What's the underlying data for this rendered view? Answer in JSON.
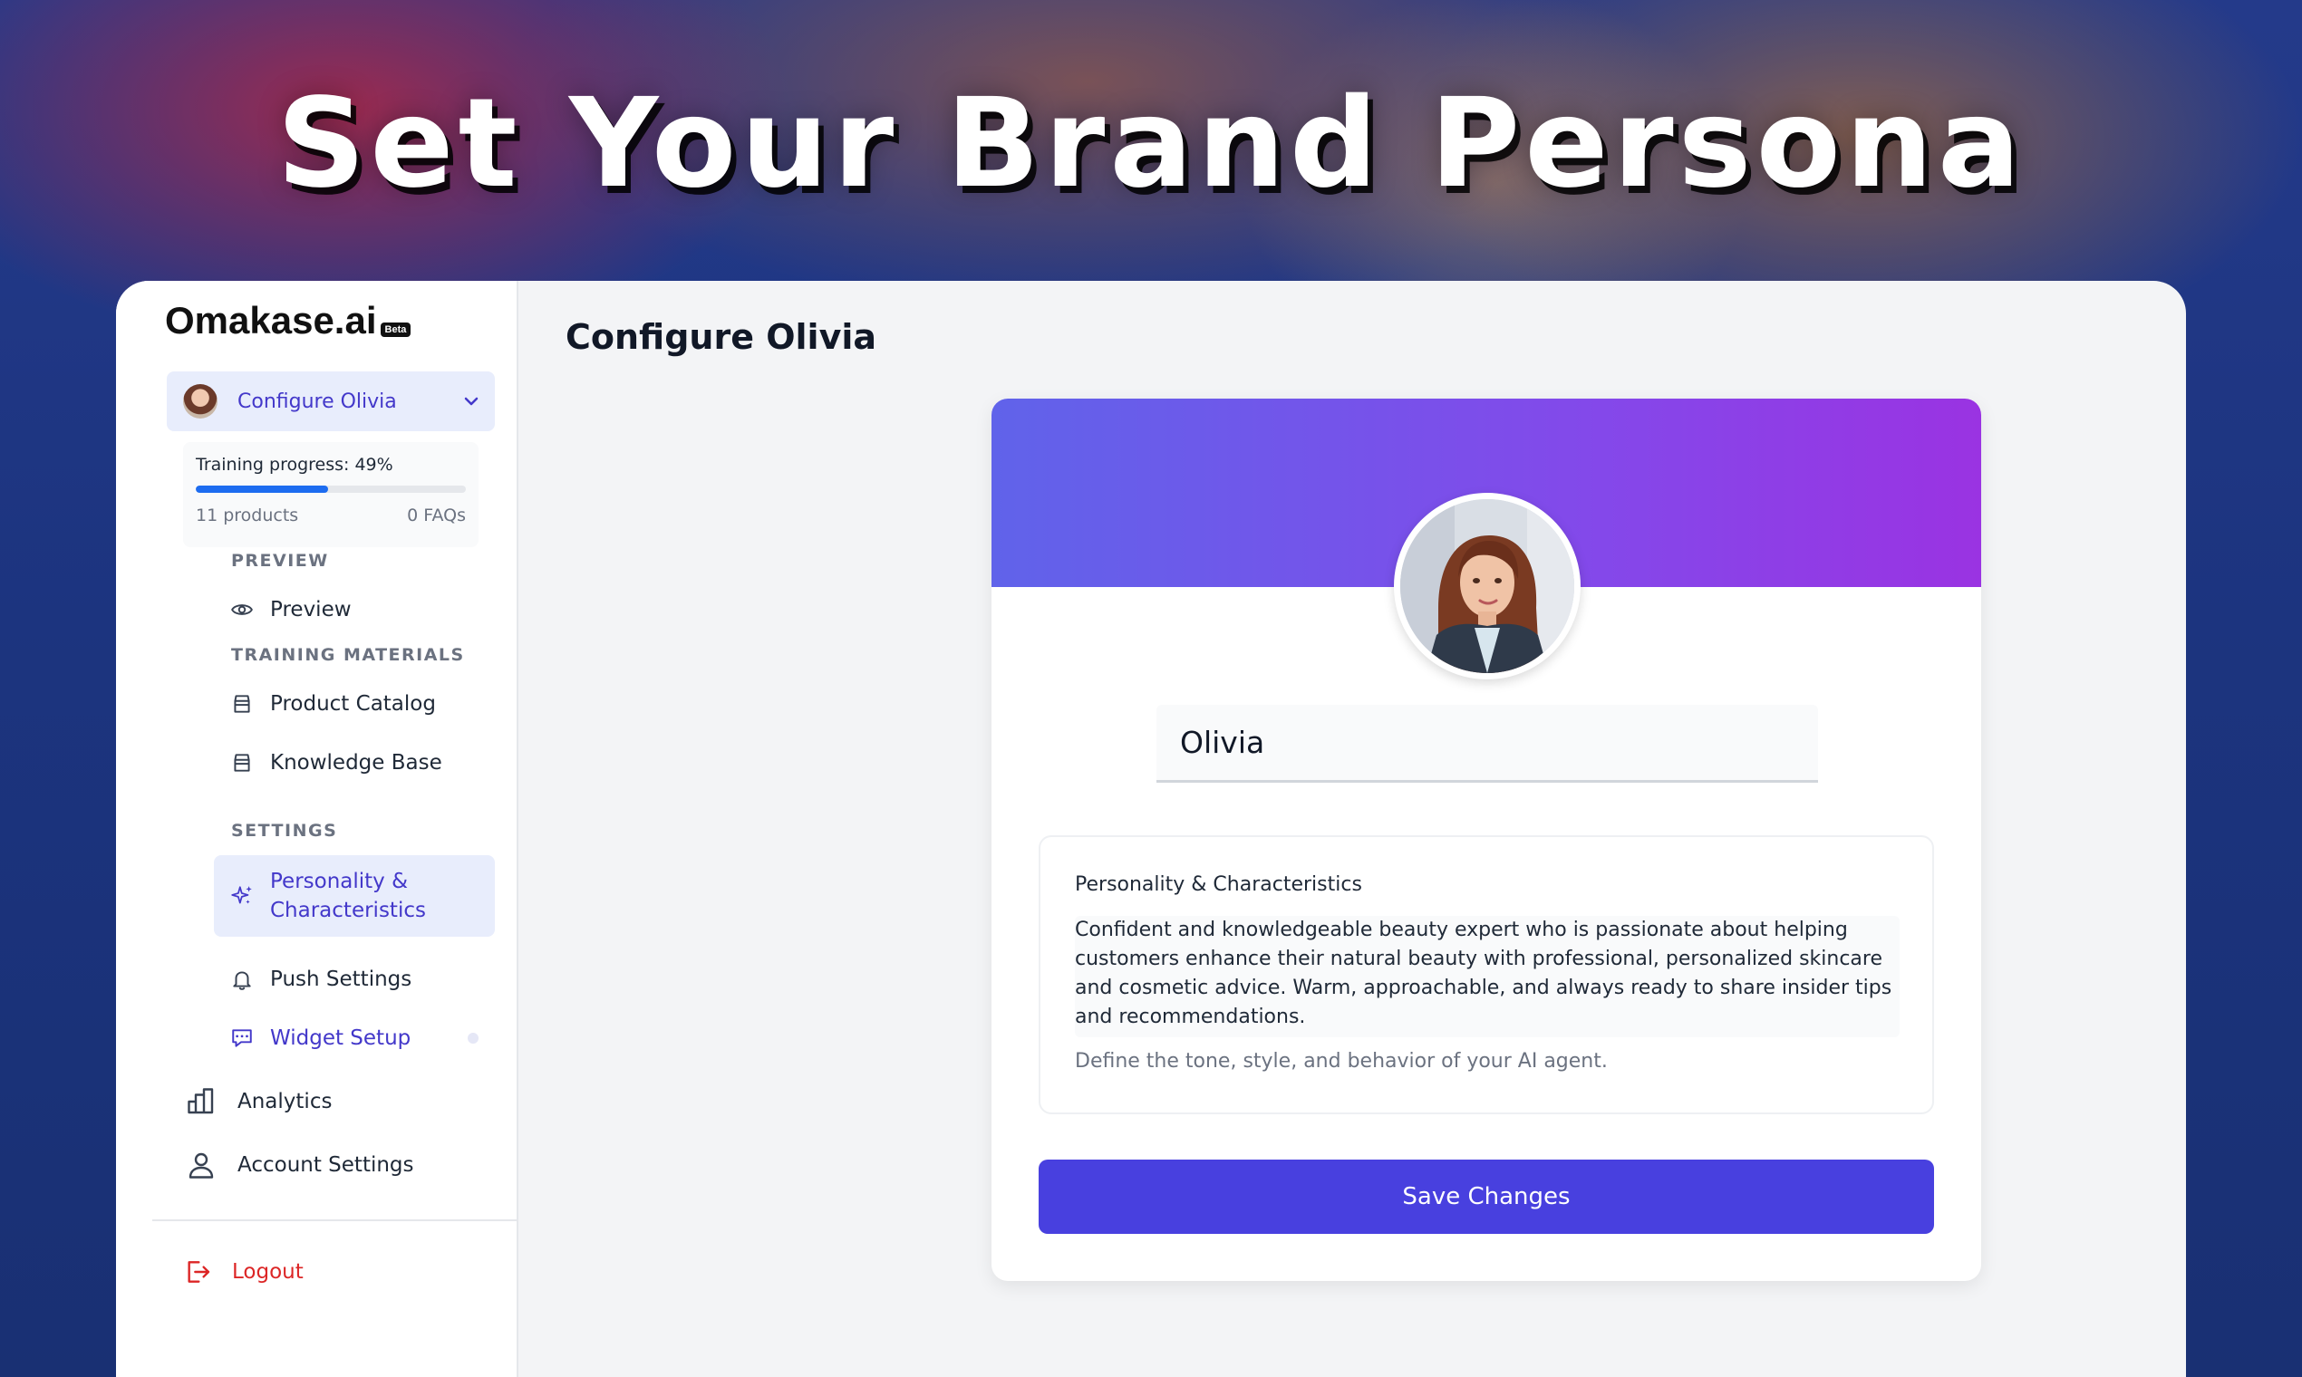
{
  "hero": {
    "title": "Set Your Brand Persona"
  },
  "sidebar": {
    "logo": "Omakase.ai",
    "beta_badge": "Beta",
    "agent_selector": {
      "label": "Configure Olivia"
    },
    "training": {
      "progress_text": "Training progress: 49%",
      "progress_fraction": 0.49,
      "products": "11 products",
      "faqs": "0 FAQs"
    },
    "sections": {
      "preview": "PREVIEW",
      "training_materials": "TRAINING MATERIALS",
      "settings": "SETTINGS"
    },
    "items": {
      "preview": "Preview",
      "product_catalog": "Product Catalog",
      "knowledge_base": "Knowledge Base",
      "personality_line1": "Personality &",
      "personality_line2": "Characteristics",
      "push_settings": "Push Settings",
      "widget_setup": "Widget Setup",
      "analytics": "Analytics",
      "account_settings": "Account Settings",
      "logout": "Logout"
    }
  },
  "main": {
    "page_title": "Configure Olivia",
    "persona": {
      "name_value": "Olivia",
      "traits_label": "Personality & Characteristics",
      "traits_value": "Confident and knowledgeable beauty expert who is passionate about helping customers enhance their natural beauty with professional, personalized skincare and cosmetic advice. Warm, approachable, and always ready to share insider tips and recommendations.",
      "traits_hint": "Define the tone, style, and behavior of your AI agent.",
      "save_label": "Save Changes"
    }
  },
  "colors": {
    "accent": "#4840df",
    "accent_text": "#4338ca",
    "active_bg": "#e8edfc",
    "progress_fill": "#1d6cf0",
    "logout": "#dc2626",
    "banner_start": "#6063ea",
    "banner_end": "#9a33e2"
  },
  "icons": {
    "preview": "eye-icon",
    "product_catalog": "archive-icon",
    "knowledge_base": "archive-icon",
    "personality": "sparkles-icon",
    "push_settings": "bell-icon",
    "widget_setup": "chat-bubble-icon",
    "analytics": "bar-chart-icon",
    "account_settings": "user-icon",
    "logout": "logout-icon",
    "selector": "chevron-down-icon"
  }
}
